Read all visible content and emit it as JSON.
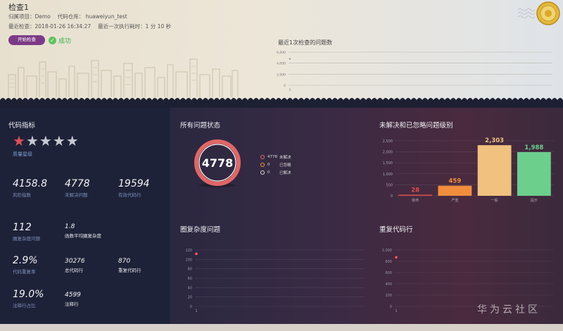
{
  "header": {
    "title": "检查1",
    "project_label": "归属项目：Demo",
    "repo_label": "代码仓库：",
    "repo_name": "huaweiyun_test",
    "last_check_label": "最近检查：2018-01-26 16:34:27",
    "last_duration_label": "最近一次执行耗时：1 分 10 秒",
    "start_button": "开始检查",
    "status": "成功"
  },
  "header_chart": {
    "title": "最近1次检查的问题数",
    "type": "line",
    "yticks": [
      "6,000",
      "4,000",
      "2,000",
      "0"
    ],
    "xticks": [
      "1"
    ],
    "x": [
      1
    ],
    "values": [
      4778
    ]
  },
  "code_metrics": {
    "title": "代码指标",
    "rating": 1,
    "rating_max": 5,
    "quality_label": "质量星级",
    "metrics": [
      {
        "value": "4158.8",
        "label": "风险指数"
      },
      {
        "value": "4778",
        "label": "未解决问题"
      },
      {
        "value": "19594",
        "label": "有效代码行"
      },
      {
        "value": "112",
        "label": "圈复杂度问题"
      },
      {
        "value": "1.8",
        "label": "函数平均圈复杂度"
      },
      {
        "value": "2.9%",
        "label": "代码重复率"
      },
      {
        "value": "30276",
        "label": "总代码行"
      },
      {
        "value": "870",
        "label": "重复代码行"
      },
      {
        "value": "19.0%",
        "label": "注释行占比"
      },
      {
        "value": "4599",
        "label": "注释行"
      }
    ]
  },
  "issue_status": {
    "title": "所有问题状态",
    "total": "4778",
    "legend": [
      {
        "count": "4778",
        "label": "未解决",
        "color": "#e26b6b"
      },
      {
        "count": "0",
        "label": "已忽略",
        "color": "#f29a3a"
      },
      {
        "count": "0",
        "label": "已解决",
        "color": "#dddddd"
      }
    ]
  },
  "level_chart": {
    "title": "未解决和已忽略问题级别",
    "chart_data": {
      "type": "bar",
      "categories": [
        "致命",
        "严重",
        "一般",
        "提示"
      ],
      "values": [
        28,
        459,
        2303,
        1988
      ],
      "value_labels": [
        "28",
        "459",
        "2,303",
        "1,988"
      ],
      "yticks": [
        "2,500",
        "2,000",
        "1,500",
        "1,000",
        "500",
        "0"
      ],
      "ylim": [
        0,
        2500
      ],
      "colors": [
        "#e04c4c",
        "#f08e3d",
        "#f1c180",
        "#6ccf8c"
      ]
    }
  },
  "complexity_chart": {
    "title": "圈复杂度问题",
    "chart_data": {
      "type": "line",
      "x": [
        1
      ],
      "values": [
        112
      ],
      "yticks": [
        "120",
        "100",
        "80",
        "60",
        "40",
        "20",
        "0"
      ],
      "xticks": [
        "1"
      ],
      "ylim": [
        0,
        120
      ]
    }
  },
  "duplicate_chart": {
    "title": "重复代码行",
    "chart_data": {
      "type": "line",
      "x": [
        1
      ],
      "values": [
        870
      ],
      "yticks": [
        "1,000",
        "800",
        "600",
        "400",
        "200",
        "0"
      ],
      "xticks": [
        "1"
      ],
      "ylim": [
        0,
        1000
      ]
    }
  },
  "watermark": "华为云社区"
}
